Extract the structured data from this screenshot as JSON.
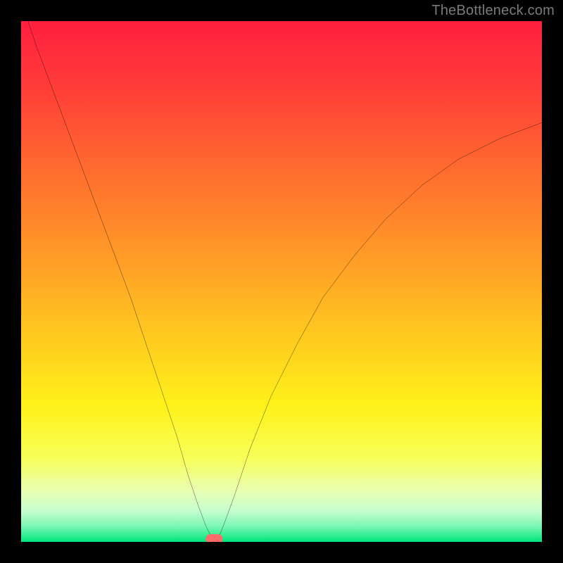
{
  "watermark": {
    "text": "TheBottleneck.com"
  },
  "chart_data": {
    "type": "line",
    "title": "",
    "xlabel": "",
    "ylabel": "",
    "xlim": [
      0,
      100
    ],
    "ylim": [
      0,
      100
    ],
    "grid": false,
    "legend": false,
    "background_gradient": {
      "direction": "top-to-bottom",
      "stops": [
        {
          "pos": 0.0,
          "color": "#ff1f3f"
        },
        {
          "pos": 0.12,
          "color": "#ff3b39"
        },
        {
          "pos": 0.28,
          "color": "#ff6a2f"
        },
        {
          "pos": 0.45,
          "color": "#ff9a27"
        },
        {
          "pos": 0.6,
          "color": "#ffc81f"
        },
        {
          "pos": 0.74,
          "color": "#fff21a"
        },
        {
          "pos": 0.84,
          "color": "#f6ff5a"
        },
        {
          "pos": 0.9,
          "color": "#eaffb0"
        },
        {
          "pos": 0.94,
          "color": "#c8ffcf"
        },
        {
          "pos": 0.97,
          "color": "#7cf7b5"
        },
        {
          "pos": 1.0,
          "color": "#00e57a"
        }
      ]
    },
    "series": [
      {
        "name": "bottleneck-curve",
        "color": "#000000",
        "stroke_width": 2.5,
        "x": [
          0,
          3,
          6,
          9,
          12,
          15,
          18,
          21,
          24,
          27,
          30,
          32,
          34,
          35.5,
          36.5,
          37.2,
          38,
          39,
          41,
          44,
          48,
          53,
          58,
          64,
          70,
          77,
          84,
          92,
          100
        ],
        "y": [
          104,
          95,
          87,
          79,
          71,
          63,
          55,
          47,
          38,
          29,
          20,
          13,
          7,
          3,
          1,
          0.3,
          1,
          3.5,
          9,
          18,
          28,
          38,
          47,
          55,
          62,
          68.5,
          73.5,
          77.5,
          80.5
        ]
      }
    ],
    "markers": [
      {
        "name": "min-marker",
        "x": 37.0,
        "y": 0.5,
        "color": "#ff6b6b",
        "shape": "capsule"
      }
    ]
  }
}
